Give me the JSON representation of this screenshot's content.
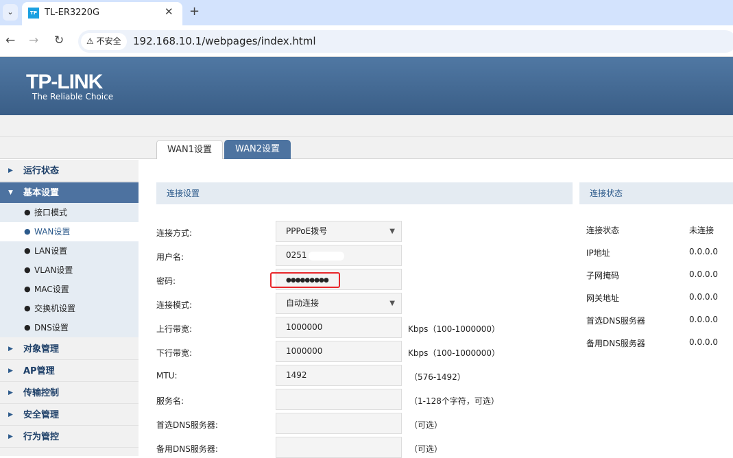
{
  "browser": {
    "tab_title": "TL-ER3220G",
    "favicon_text": "TP",
    "security_label": "不安全",
    "url": "192.168.10.1/webpages/index.html"
  },
  "header": {
    "logo": "TP-LINK",
    "slogan": "The Reliable Choice"
  },
  "tabs": [
    {
      "label": "WAN1设置",
      "active": true
    },
    {
      "label": "WAN2设置",
      "active": false
    }
  ],
  "sidebar": {
    "top": [
      {
        "label": "运行状态"
      },
      {
        "label": "基本设置"
      }
    ],
    "sub": [
      {
        "label": "接口模式"
      },
      {
        "label": "WAN设置"
      },
      {
        "label": "LAN设置"
      },
      {
        "label": "VLAN设置"
      },
      {
        "label": "MAC设置"
      },
      {
        "label": "交换机设置"
      },
      {
        "label": "DNS设置"
      }
    ],
    "bottom": [
      {
        "label": "对象管理"
      },
      {
        "label": "AP管理"
      },
      {
        "label": "传输控制"
      },
      {
        "label": "安全管理"
      },
      {
        "label": "行为管控"
      }
    ]
  },
  "form": {
    "title": "连接设置",
    "rows": [
      {
        "label": "连接方式:",
        "value": "PPPoE拨号",
        "hint": ""
      },
      {
        "label": "用户名:",
        "value": "0251",
        "hint": ""
      },
      {
        "label": "密码:",
        "value": "●●●●●●●●●",
        "hint": ""
      },
      {
        "label": "连接模式:",
        "value": "自动连接",
        "hint": ""
      },
      {
        "label": "上行带宽:",
        "value": "1000000",
        "hint": "Kbps（100-1000000）"
      },
      {
        "label": "下行带宽:",
        "value": "1000000",
        "hint": "Kbps（100-1000000）"
      },
      {
        "label": "MTU:",
        "value": "1492",
        "hint": "（576-1492）"
      },
      {
        "label": "服务名:",
        "value": "",
        "hint": "（1-128个字符，可选）"
      },
      {
        "label": "首选DNS服务器:",
        "value": "",
        "hint": "（可选）"
      },
      {
        "label": "备用DNS服务器:",
        "value": "",
        "hint": "（可选）"
      }
    ]
  },
  "status": {
    "title": "连接状态",
    "rows": [
      {
        "label": "连接状态",
        "value": "未连接"
      },
      {
        "label": "IP地址",
        "value": "0.0.0.0"
      },
      {
        "label": "子网掩码",
        "value": "0.0.0.0"
      },
      {
        "label": "网关地址",
        "value": "0.0.0.0"
      },
      {
        "label": "首选DNS服务器",
        "value": "0.0.0.0"
      },
      {
        "label": "备用DNS服务器",
        "value": "0.0.0.0"
      }
    ]
  }
}
